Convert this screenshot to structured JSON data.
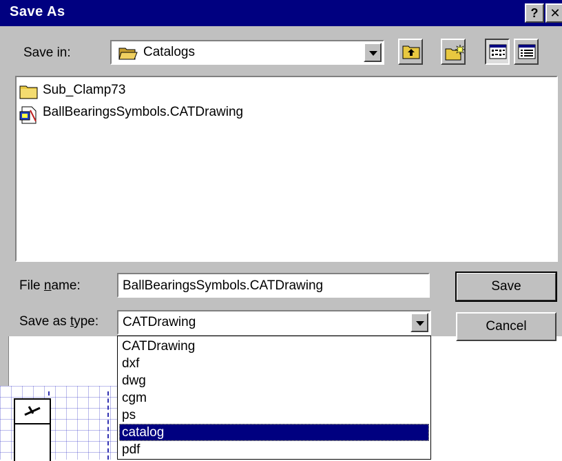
{
  "dialog": {
    "title": "Save As",
    "help_label": "?",
    "close_label": "✕"
  },
  "save_in": {
    "label": "Save in:",
    "value": "Catalogs"
  },
  "files": [
    {
      "name": "Sub_Clamp73",
      "icon": "folder-icon"
    },
    {
      "name": "BallBearingsSymbols.CATDrawing",
      "icon": "catdrawing-file-icon"
    }
  ],
  "file_name": {
    "label": "File name:",
    "value": "BallBearingsSymbols.CATDrawing"
  },
  "save_as_type": {
    "label": "Save as type:",
    "value": "CATDrawing",
    "options": [
      "CATDrawing",
      "dxf",
      "dwg",
      "cgm",
      "ps",
      "catalog",
      "pdf"
    ],
    "highlighted": "catalog"
  },
  "buttons": {
    "save": "Save",
    "cancel": "Cancel"
  },
  "background": {
    "edge_letter": "e"
  },
  "colors": {
    "titlebar": "#000080",
    "face": "#c0c0c0",
    "selection": "#000080"
  }
}
